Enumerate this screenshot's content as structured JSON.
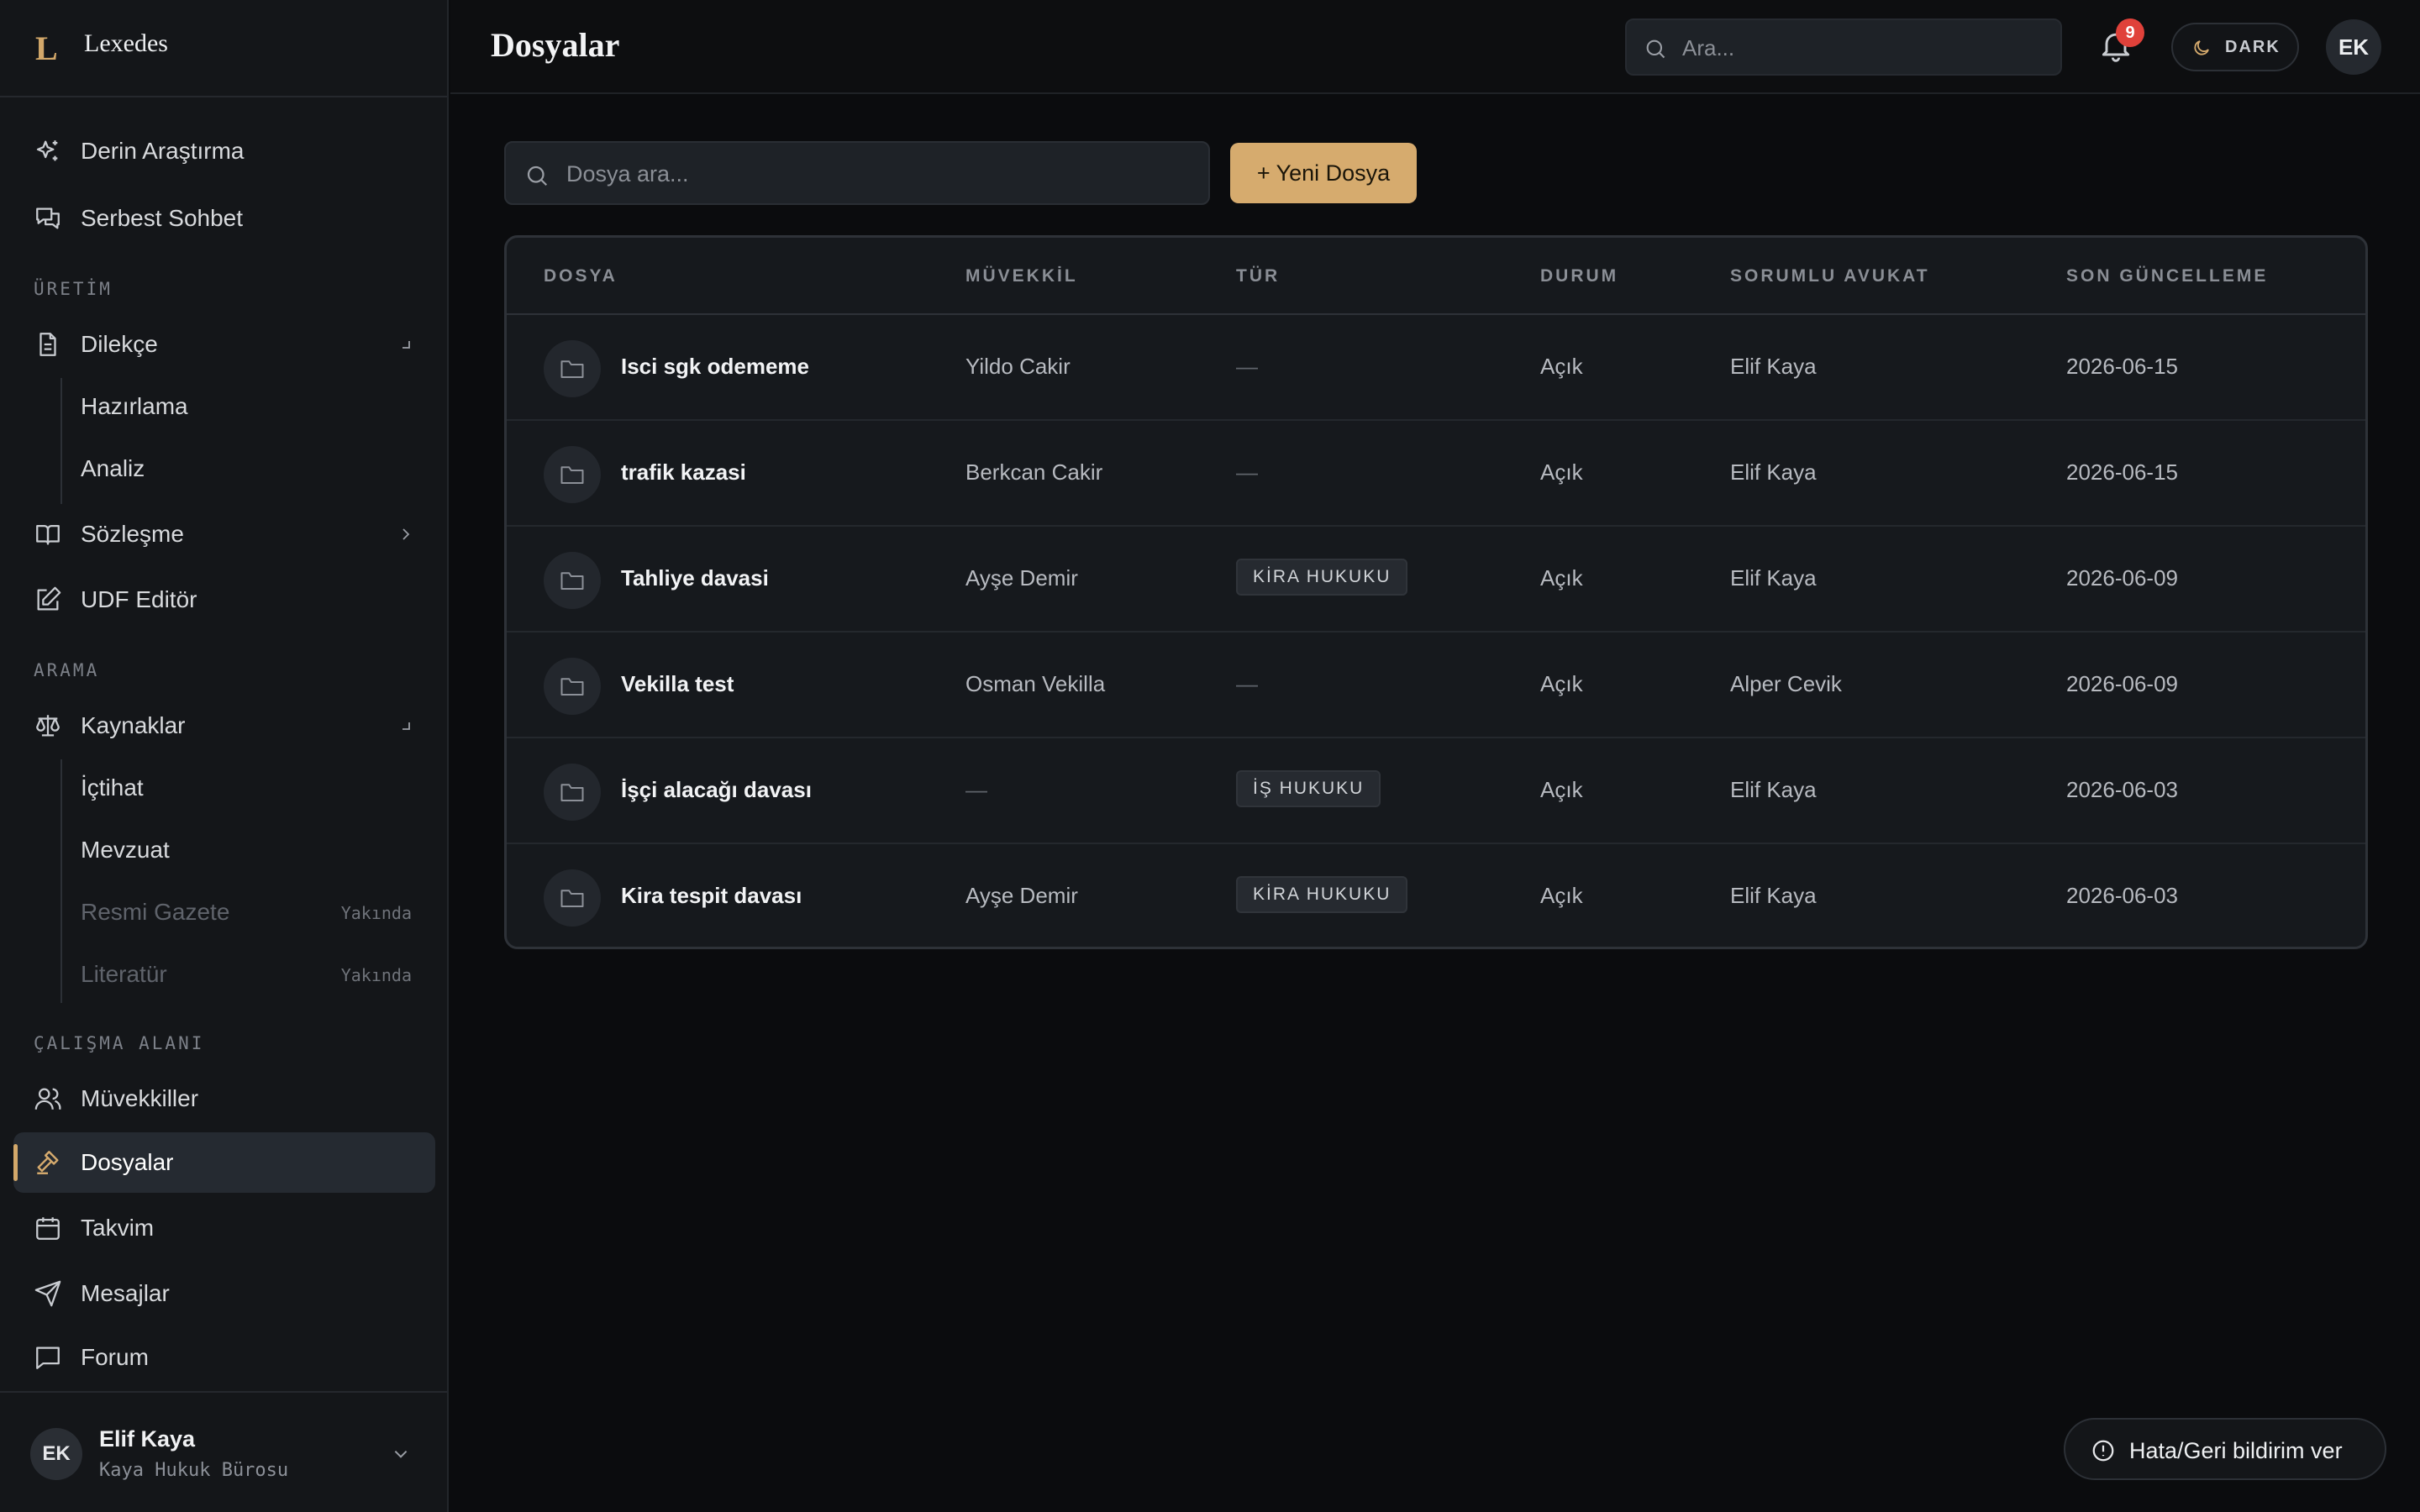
{
  "brand": {
    "logo": "L",
    "name": "Lexedes"
  },
  "sidebar": {
    "top_items": [
      {
        "label": "Derin Araştırma",
        "icon": "sparkles-icon"
      },
      {
        "label": "Serbest Sohbet",
        "icon": "chat-icon"
      }
    ],
    "sections": {
      "uretim": "ÜRETİM",
      "arama": "ARAMA",
      "calisma": "ÇALIŞMA ALANI"
    },
    "dilekce": {
      "label": "Dilekçe",
      "children": [
        "Hazırlama",
        "Analiz"
      ]
    },
    "sozlesme": {
      "label": "Sözleşme"
    },
    "udf": {
      "label": "UDF Editör"
    },
    "kaynaklar": {
      "label": "Kaynaklar",
      "children": [
        "İçtihat",
        "Mevzuat",
        "Resmi Gazete",
        "Literatür"
      ],
      "soon_label": "Yakında"
    },
    "workspace_items": [
      "Müvekkiller",
      "Dosyalar",
      "Takvim",
      "Mesajlar",
      "Forum"
    ],
    "active_item": "Dosyalar"
  },
  "user": {
    "initials": "EK",
    "name": "Elif Kaya",
    "firm": "Kaya Hukuk Bürosu"
  },
  "header": {
    "title": "Dosyalar",
    "search_placeholder": "Ara...",
    "notification_count": "9",
    "theme_label": "DARK",
    "avatar_initials": "EK"
  },
  "files": {
    "search_placeholder": "Dosya ara...",
    "new_button": "+ Yeni Dosya",
    "columns": [
      "DOSYA",
      "MÜVEKKİL",
      "TÜR",
      "DURUM",
      "SORUMLU AVUKAT",
      "SON GÜNCELLEME"
    ],
    "rows": [
      {
        "name": "Isci sgk odememe",
        "client": "Yildo Cakir",
        "type": "—",
        "status": "Açık",
        "lawyer": "Elif Kaya",
        "updated": "2026-06-15"
      },
      {
        "name": "trafik kazasi",
        "client": "Berkcan Cakir",
        "type": "—",
        "status": "Açık",
        "lawyer": "Elif Kaya",
        "updated": "2026-06-15"
      },
      {
        "name": "Tahliye davasi",
        "client": "Ayşe Demir",
        "type": "KİRA HUKUKU",
        "status": "Açık",
        "lawyer": "Elif Kaya",
        "updated": "2026-06-09"
      },
      {
        "name": "Vekilla test",
        "client": "Osman Vekilla",
        "type": "—",
        "status": "Açık",
        "lawyer": "Alper Cevik",
        "updated": "2026-06-09"
      },
      {
        "name": "İşçi alacağı davası",
        "client": "—",
        "type": "İŞ HUKUKU",
        "status": "Açık",
        "lawyer": "Elif Kaya",
        "updated": "2026-06-03"
      },
      {
        "name": "Kira tespit davası",
        "client": "Ayşe Demir",
        "type": "KİRA HUKUKU",
        "status": "Açık",
        "lawyer": "Elif Kaya",
        "updated": "2026-06-03"
      }
    ]
  },
  "feedback": {
    "label": "Hata/Geri bildirim ver"
  },
  "colors": {
    "accent": "#d6ab6e",
    "badge": "#e0413a",
    "background": "#0b0c0e",
    "sidebar": "#141619"
  }
}
